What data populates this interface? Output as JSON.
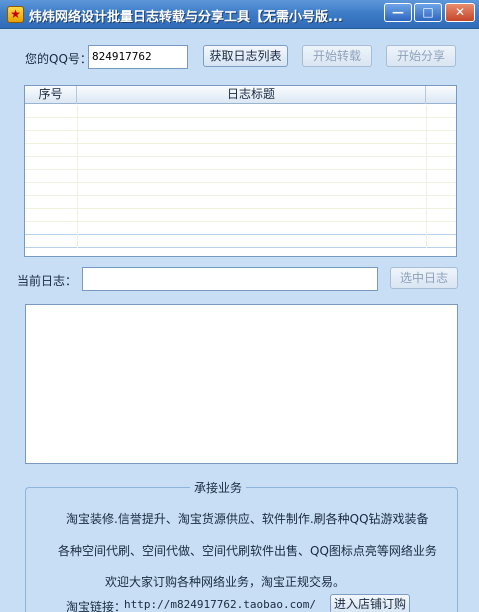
{
  "window": {
    "title": "炜炜网络设计批量日志转载与分享工具【无需小号版...",
    "icon": "app-star-icon",
    "min_glyph": "—",
    "max_glyph": "□",
    "close_glyph": "✕"
  },
  "qq": {
    "label": "您的QQ号：",
    "value": "824917762"
  },
  "buttons": {
    "fetch": "获取日志列表",
    "start_repost": "开始转载",
    "start_share": "开始分享",
    "select_log": "选中日志",
    "enter_shop": "进入店铺订购"
  },
  "table": {
    "columns": [
      "序号",
      "日志标题",
      ""
    ],
    "rows": []
  },
  "current_log": {
    "label": "当前日志：",
    "value": ""
  },
  "services": {
    "title": "承接业务",
    "lines": [
      "淘宝装修.信誉提升、淘宝货源供应、软件制作.刷各种QQ钻游戏装备",
      "各种空间代刷、空间代做、空间代刷软件出售、QQ图标点亮等网络业务",
      "欢迎大家订购各种网络业务，淘宝正规交易。"
    ],
    "link_label": "淘宝链接：",
    "link_url": "http://m824917762.taobao.com/"
  },
  "colors": {
    "titlebar": "#3f7dc8",
    "background": "#c7def4",
    "border": "#7a99c0"
  }
}
